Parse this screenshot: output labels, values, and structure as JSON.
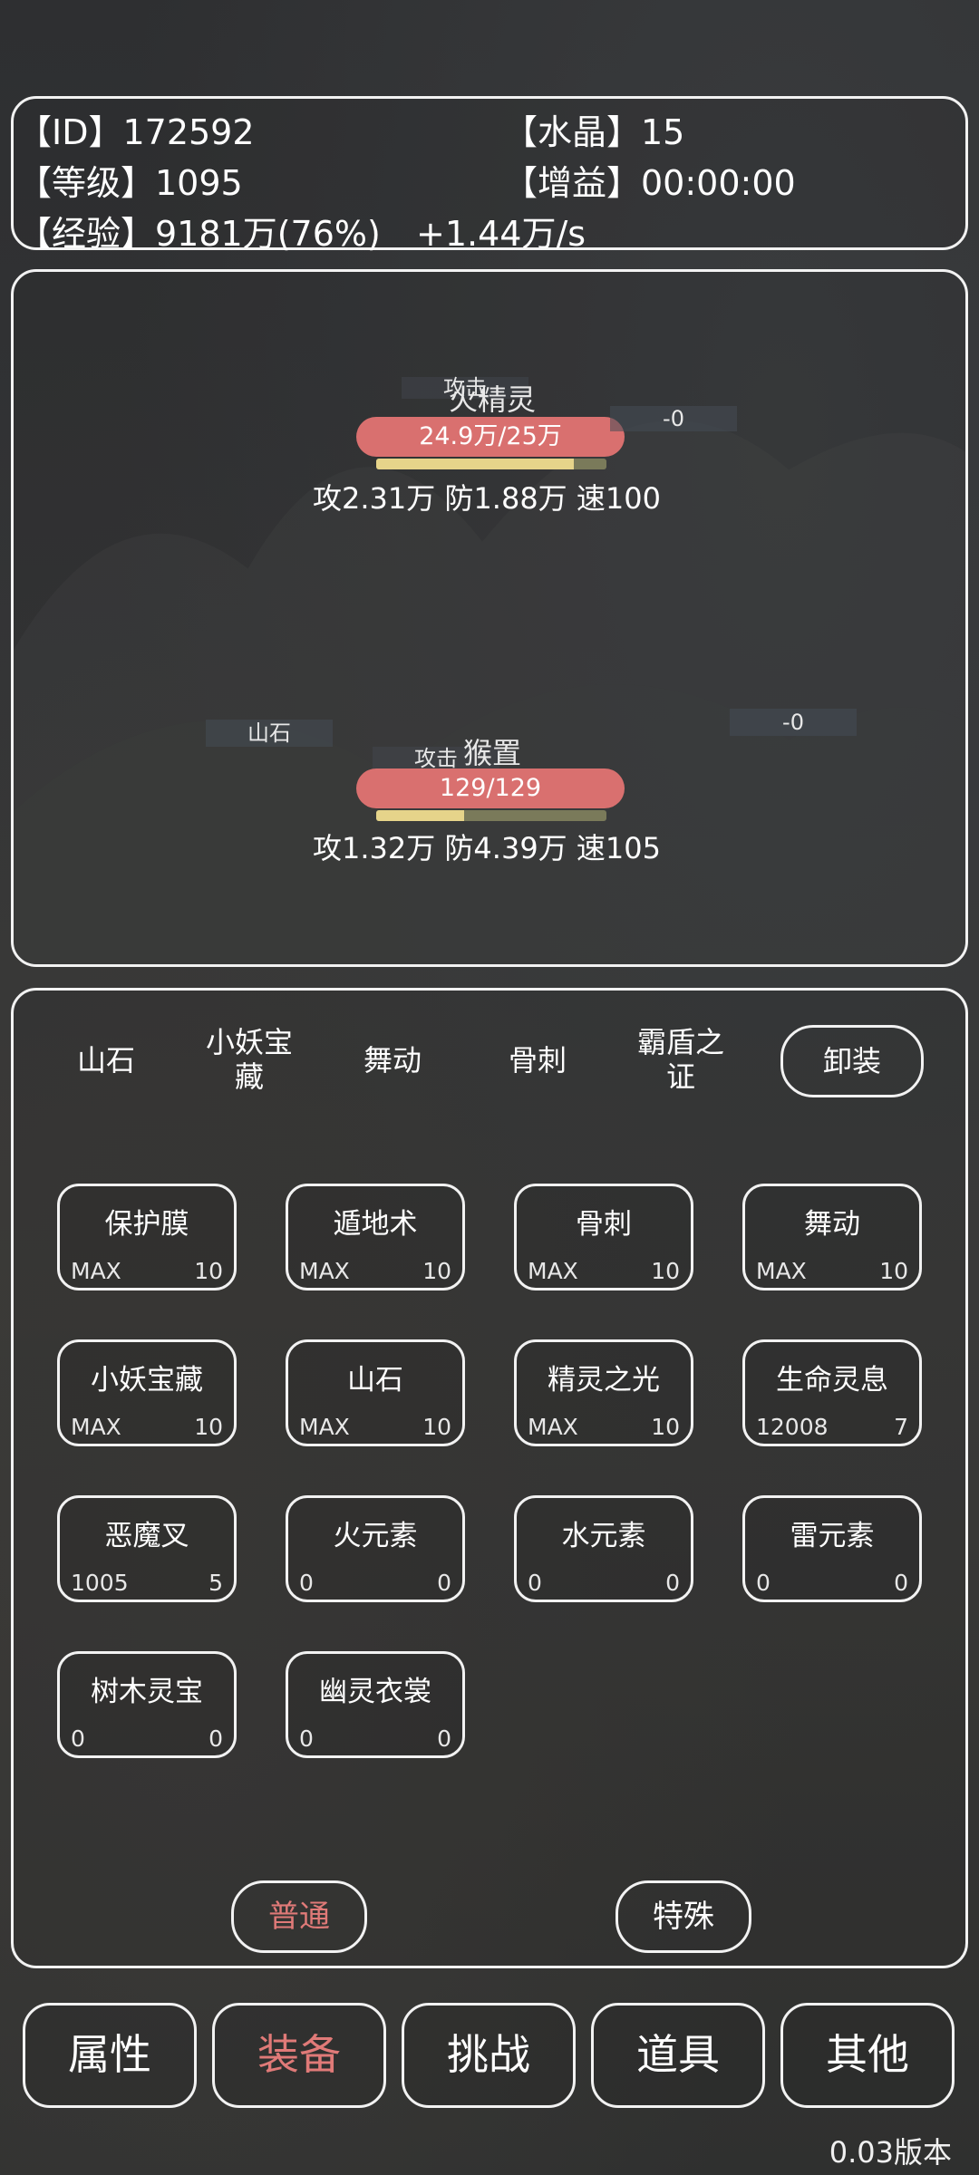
{
  "info": {
    "id_label": "【ID】172592",
    "crystal_label": "【水晶】15",
    "level_label": "【等级】1095",
    "buff_label": "【增益】00:00:00",
    "exp_label": "【经验】9181万(76%)",
    "exp_rate": "+1.44万/s"
  },
  "battle": {
    "enemy": {
      "name": "火精灵",
      "action": "攻击",
      "hp": "24.9万/25万",
      "hp_fraction": 0.996,
      "exp_fraction": 0.86,
      "stats": "攻2.31万  防1.88万  速100",
      "damage": "-0"
    },
    "player": {
      "name": "猴置",
      "action": "攻击",
      "hp": "129/129",
      "hp_fraction": 1.0,
      "exp_fraction": 0.38,
      "stats": "攻1.32万  防4.39万  速105",
      "damage": "-0",
      "skill_tag": "山石"
    }
  },
  "equip": {
    "slots": [
      "山石",
      "小妖宝藏",
      "舞动",
      "骨刺",
      "霸盾之证"
    ],
    "unequip_label": "卸装",
    "items": [
      {
        "name": "保护膜",
        "left": "MAX",
        "right": "10"
      },
      {
        "name": "遁地术",
        "left": "MAX",
        "right": "10"
      },
      {
        "name": "骨刺",
        "left": "MAX",
        "right": "10"
      },
      {
        "name": "舞动",
        "left": "MAX",
        "right": "10"
      },
      {
        "name": "小妖宝藏",
        "left": "MAX",
        "right": "10"
      },
      {
        "name": "山石",
        "left": "MAX",
        "right": "10"
      },
      {
        "name": "精灵之光",
        "left": "MAX",
        "right": "10"
      },
      {
        "name": "生命灵息",
        "left": "12008",
        "right": "7"
      },
      {
        "name": "恶魔叉",
        "left": "1005",
        "right": "5"
      },
      {
        "name": "火元素",
        "left": "0",
        "right": "0"
      },
      {
        "name": "水元素",
        "left": "0",
        "right": "0"
      },
      {
        "name": "雷元素",
        "left": "0",
        "right": "0"
      },
      {
        "name": "树木灵宝",
        "left": "0",
        "right": "0"
      },
      {
        "name": "幽灵衣裳",
        "left": "0",
        "right": "0"
      }
    ],
    "tab_normal": "普通",
    "tab_special": "特殊"
  },
  "nav": [
    "属性",
    "装备",
    "挑战",
    "道具",
    "其他"
  ],
  "version": "0.03版本",
  "colors": {
    "accent": "#e07a78",
    "hp": "#d9706f",
    "border": "#f2f2f2"
  }
}
